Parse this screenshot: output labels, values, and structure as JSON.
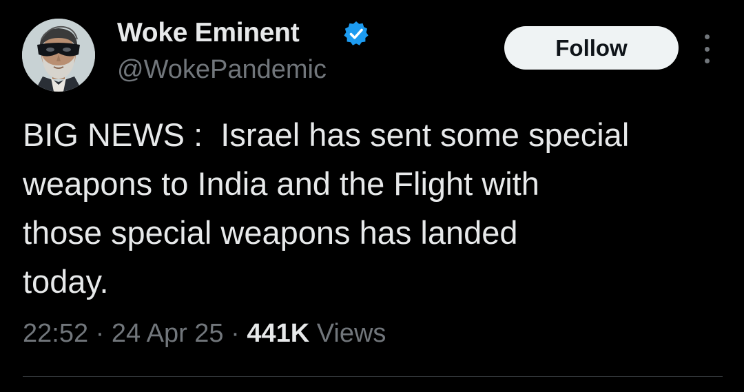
{
  "author": {
    "display_name": "Woke Eminent",
    "handle": "@WokePandemic",
    "verified": true,
    "avatar_icon": "masked-man-avatar"
  },
  "actions": {
    "follow_label": "Follow",
    "more_icon": "more-options-icon"
  },
  "tweet": {
    "text": "BIG NEWS :  Israel has sent some special\nweapons to India and the Flight with\nthose special weapons has landed\ntoday."
  },
  "meta": {
    "time": "22:52",
    "separator": "·",
    "date": "24 Apr 25",
    "views_count": "441K",
    "views_label": "Views"
  },
  "colors": {
    "background": "#000000",
    "primary_text": "#e7e9ea",
    "secondary_text": "#71767b",
    "verified_blue": "#1d9bf0",
    "follow_bg": "#eff3f4",
    "divider": "#2f3336"
  }
}
